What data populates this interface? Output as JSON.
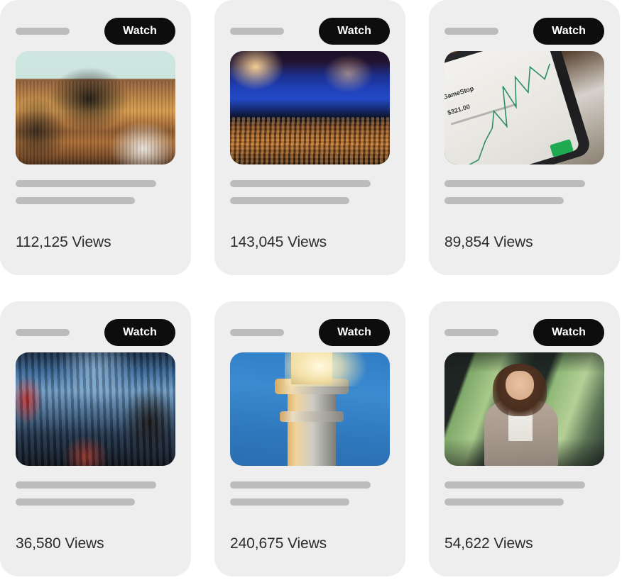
{
  "page": {
    "background_color": "#ffffff",
    "card_background_color": "#eeeeee",
    "skeleton_color": "#bcbcbc",
    "accent_color": "#0d0d0d",
    "views_text_color": "#2c2c2c"
  },
  "cards": [
    {
      "watch_label": "Watch",
      "views_label": "112,125 Views",
      "thumbnail": "stage-talk-photo",
      "thumbnail_alt": "Speaker seated on stage in front of teal projection screen"
    },
    {
      "watch_label": "Watch",
      "views_label": "143,045 Views",
      "thumbnail": "concert-crowd-photo",
      "thumbnail_alt": "Large concert audience with blue stage lighting"
    },
    {
      "watch_label": "Watch",
      "views_label": "89,854 Views",
      "thumbnail": "stock-phone-photo",
      "thumbnail_alt": "Smartphone showing GameStop stock chart",
      "overlay_text": {
        "ticker_name": "GameStop",
        "ticker_price": "$321.00"
      }
    },
    {
      "watch_label": "Watch",
      "views_label": "36,580 Views",
      "thumbnail": "audience-photo",
      "thumbnail_alt": "Seated audience in blue-lit auditorium"
    },
    {
      "watch_label": "Watch",
      "views_label": "240,675 Views",
      "thumbnail": "lighthouse-photo",
      "thumbnail_alt": "Lighthouse lamp glowing against blue sky"
    },
    {
      "watch_label": "Watch",
      "views_label": "54,622 Views",
      "thumbnail": "portrait-photo",
      "thumbnail_alt": "Smiling woman with arms crossed in front of windows"
    }
  ]
}
